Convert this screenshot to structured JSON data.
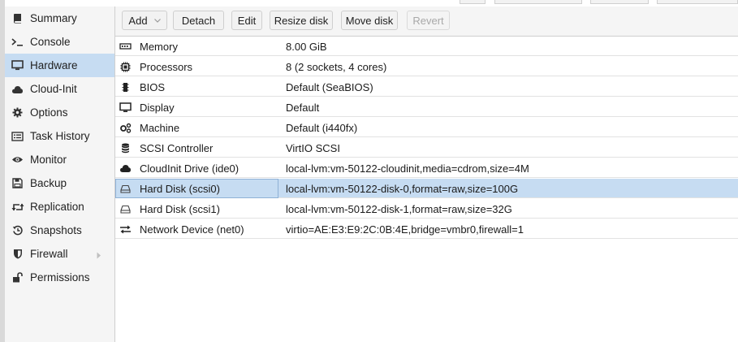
{
  "sidebar": {
    "items": [
      {
        "label": "Summary",
        "icon": "book-icon"
      },
      {
        "label": "Console",
        "icon": "terminal-icon"
      },
      {
        "label": "Hardware",
        "icon": "desktop-icon",
        "active": true
      },
      {
        "label": "Cloud-Init",
        "icon": "cloud-icon"
      },
      {
        "label": "Options",
        "icon": "gear-icon"
      },
      {
        "label": "Task History",
        "icon": "list-icon"
      },
      {
        "label": "Monitor",
        "icon": "eye-icon"
      },
      {
        "label": "Backup",
        "icon": "floppy-icon"
      },
      {
        "label": "Replication",
        "icon": "retweet-icon"
      },
      {
        "label": "Snapshots",
        "icon": "history-icon"
      },
      {
        "label": "Firewall",
        "icon": "shield-icon",
        "has_submenu": true
      },
      {
        "label": "Permissions",
        "icon": "unlock-icon"
      }
    ]
  },
  "toolbar": {
    "add_label": "Add",
    "detach_label": "Detach",
    "edit_label": "Edit",
    "resize_label": "Resize disk",
    "move_label": "Move disk",
    "revert_label": "Revert"
  },
  "hardware": {
    "rows": [
      {
        "name": "Memory",
        "value": "8.00 GiB",
        "icon": "memory-icon"
      },
      {
        "name": "Processors",
        "value": "8 (2 sockets, 4 cores)",
        "icon": "cpu-icon"
      },
      {
        "name": "BIOS",
        "value": "Default (SeaBIOS)",
        "icon": "chip-icon"
      },
      {
        "name": "Display",
        "value": "Default",
        "icon": "monitor-icon"
      },
      {
        "name": "Machine",
        "value": "Default (i440fx)",
        "icon": "cogs-icon"
      },
      {
        "name": "SCSI Controller",
        "value": "VirtIO SCSI",
        "icon": "database-icon"
      },
      {
        "name": "CloudInit Drive (ide0)",
        "value": "local-lvm:vm-50122-cloudinit,media=cdrom,size=4M",
        "icon": "cloud-icon"
      },
      {
        "name": "Hard Disk (scsi0)",
        "value": "local-lvm:vm-50122-disk-0,format=raw,size=100G",
        "icon": "hdd-icon",
        "selected": true
      },
      {
        "name": "Hard Disk (scsi1)",
        "value": "local-lvm:vm-50122-disk-1,format=raw,size=32G",
        "icon": "hdd-icon"
      },
      {
        "name": "Network Device (net0)",
        "value": "virtio=AE:E3:E9:2C:0B:4E,bridge=vmbr0,firewall=1",
        "icon": "exchange-icon"
      }
    ]
  },
  "colors": {
    "selection": "#c6dcf2",
    "sidebar_bg": "#f5f5f5",
    "border": "#cfcfcf"
  }
}
